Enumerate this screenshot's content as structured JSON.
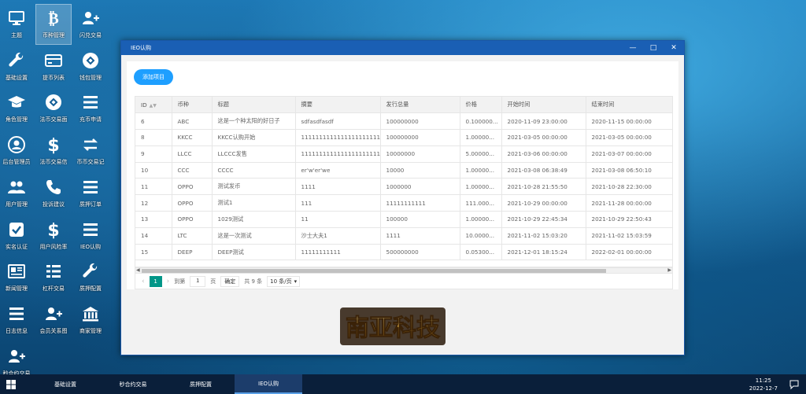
{
  "desktop_icons": [
    {
      "label": "主题",
      "icon": "monitor-icon"
    },
    {
      "label": "币种管理",
      "icon": "bitcoin-icon",
      "selected": true
    },
    {
      "label": "闪兑交易",
      "icon": "user-plus-icon"
    },
    {
      "label": "基础设置",
      "icon": "wrench-icon"
    },
    {
      "label": "提币列表",
      "icon": "credit-card-icon"
    },
    {
      "label": "钱包管理",
      "icon": "link-circle-icon"
    },
    {
      "label": "角色管理",
      "icon": "graduation-cap-icon"
    },
    {
      "label": "法币交易面",
      "icon": "link-circle-icon"
    },
    {
      "label": "充币申请",
      "icon": "list-icon"
    },
    {
      "label": "后台管理员",
      "icon": "user-circle-icon"
    },
    {
      "label": "法币交易信",
      "icon": "dollar-icon"
    },
    {
      "label": "币币交易记",
      "icon": "exchange-icon"
    },
    {
      "label": "用户管理",
      "icon": "users-icon"
    },
    {
      "label": "投诉建议",
      "icon": "phone-icon"
    },
    {
      "label": "质押订单",
      "icon": "list-icon"
    },
    {
      "label": "实名认证",
      "icon": "check-square-icon"
    },
    {
      "label": "用户风险率",
      "icon": "dollar-icon"
    },
    {
      "label": "IEO认购",
      "icon": "list-icon"
    },
    {
      "label": "新闻管理",
      "icon": "newspaper-icon"
    },
    {
      "label": "杠杆交易",
      "icon": "grid-icon"
    },
    {
      "label": "质押配置",
      "icon": "wrench-icon"
    },
    {
      "label": "日志信息",
      "icon": "list-icon"
    },
    {
      "label": "会员关系图",
      "icon": "user-plus-icon"
    },
    {
      "label": "商家管理",
      "icon": "bank-icon"
    },
    {
      "label": "秒合约交易",
      "icon": "user-plus-icon"
    }
  ],
  "window": {
    "title": "IEO认购",
    "add_button": "添加项目",
    "columns": [
      "ID",
      "币种",
      "标题",
      "摘要",
      "发行总量",
      "价格",
      "开始时间",
      "结束时间"
    ],
    "rows": [
      [
        "6",
        "ABC",
        "这是一个种太阳的好日子",
        "sdfasdfasdf",
        "100000000",
        "0.100000...",
        "2020-11-09 23:00:00",
        "2020-11-15 00:00:00"
      ],
      [
        "8",
        "KKCC",
        "KKCC认购开始",
        "1111111111111111111111...",
        "100000000",
        "1.00000...",
        "2021-03-05 00:00:00",
        "2021-03-05 00:00:00"
      ],
      [
        "9",
        "LLCC",
        "LLCCC发售",
        "1111111111111111111111...",
        "10000000",
        "5.00000...",
        "2021-03-06 00:00:00",
        "2021-03-07 00:00:00"
      ],
      [
        "10",
        "CCC",
        "CCCC",
        "er'w'er'we",
        "10000",
        "1.00000...",
        "2021-03-08 06:38:49",
        "2021-03-08 06:50:10"
      ],
      [
        "11",
        "OPPO",
        "测试发币",
        "1111",
        "1000000",
        "1.00000...",
        "2021-10-28 21:55:50",
        "2021-10-28 22:30:00"
      ],
      [
        "12",
        "OPPO",
        "测试1",
        "111",
        "11111111111",
        "111.000...",
        "2021-10-29 00:00:00",
        "2021-11-28 00:00:00"
      ],
      [
        "13",
        "OPPO",
        "1029测试",
        "11",
        "100000",
        "1.00000...",
        "2021-10-29 22:45:34",
        "2021-10-29 22:50:43"
      ],
      [
        "14",
        "LTC",
        "这是一次测试",
        "沙士大夫1",
        "1111",
        "10.0000...",
        "2021-11-02 15:03:20",
        "2021-11-02 15:03:59"
      ],
      [
        "15",
        "DEEP",
        "DEEP测试",
        "11111111111",
        "500000000",
        "0.05300...",
        "2021-12-01 18:15:24",
        "2022-02-01 00:00:00"
      ]
    ],
    "pager": {
      "current": "1",
      "goto_label": "到第",
      "goto_value": "1",
      "page_unit": "页",
      "confirm": "确定",
      "total": "共 9 条",
      "page_size": "10 条/页"
    },
    "logo_text": "南亚科技"
  },
  "taskbar": {
    "items": [
      "基础设置",
      "秒合约交易",
      "质押配置",
      "IEO认购"
    ],
    "active_index": 3,
    "time": "11:25",
    "date": "2022-12-7"
  }
}
